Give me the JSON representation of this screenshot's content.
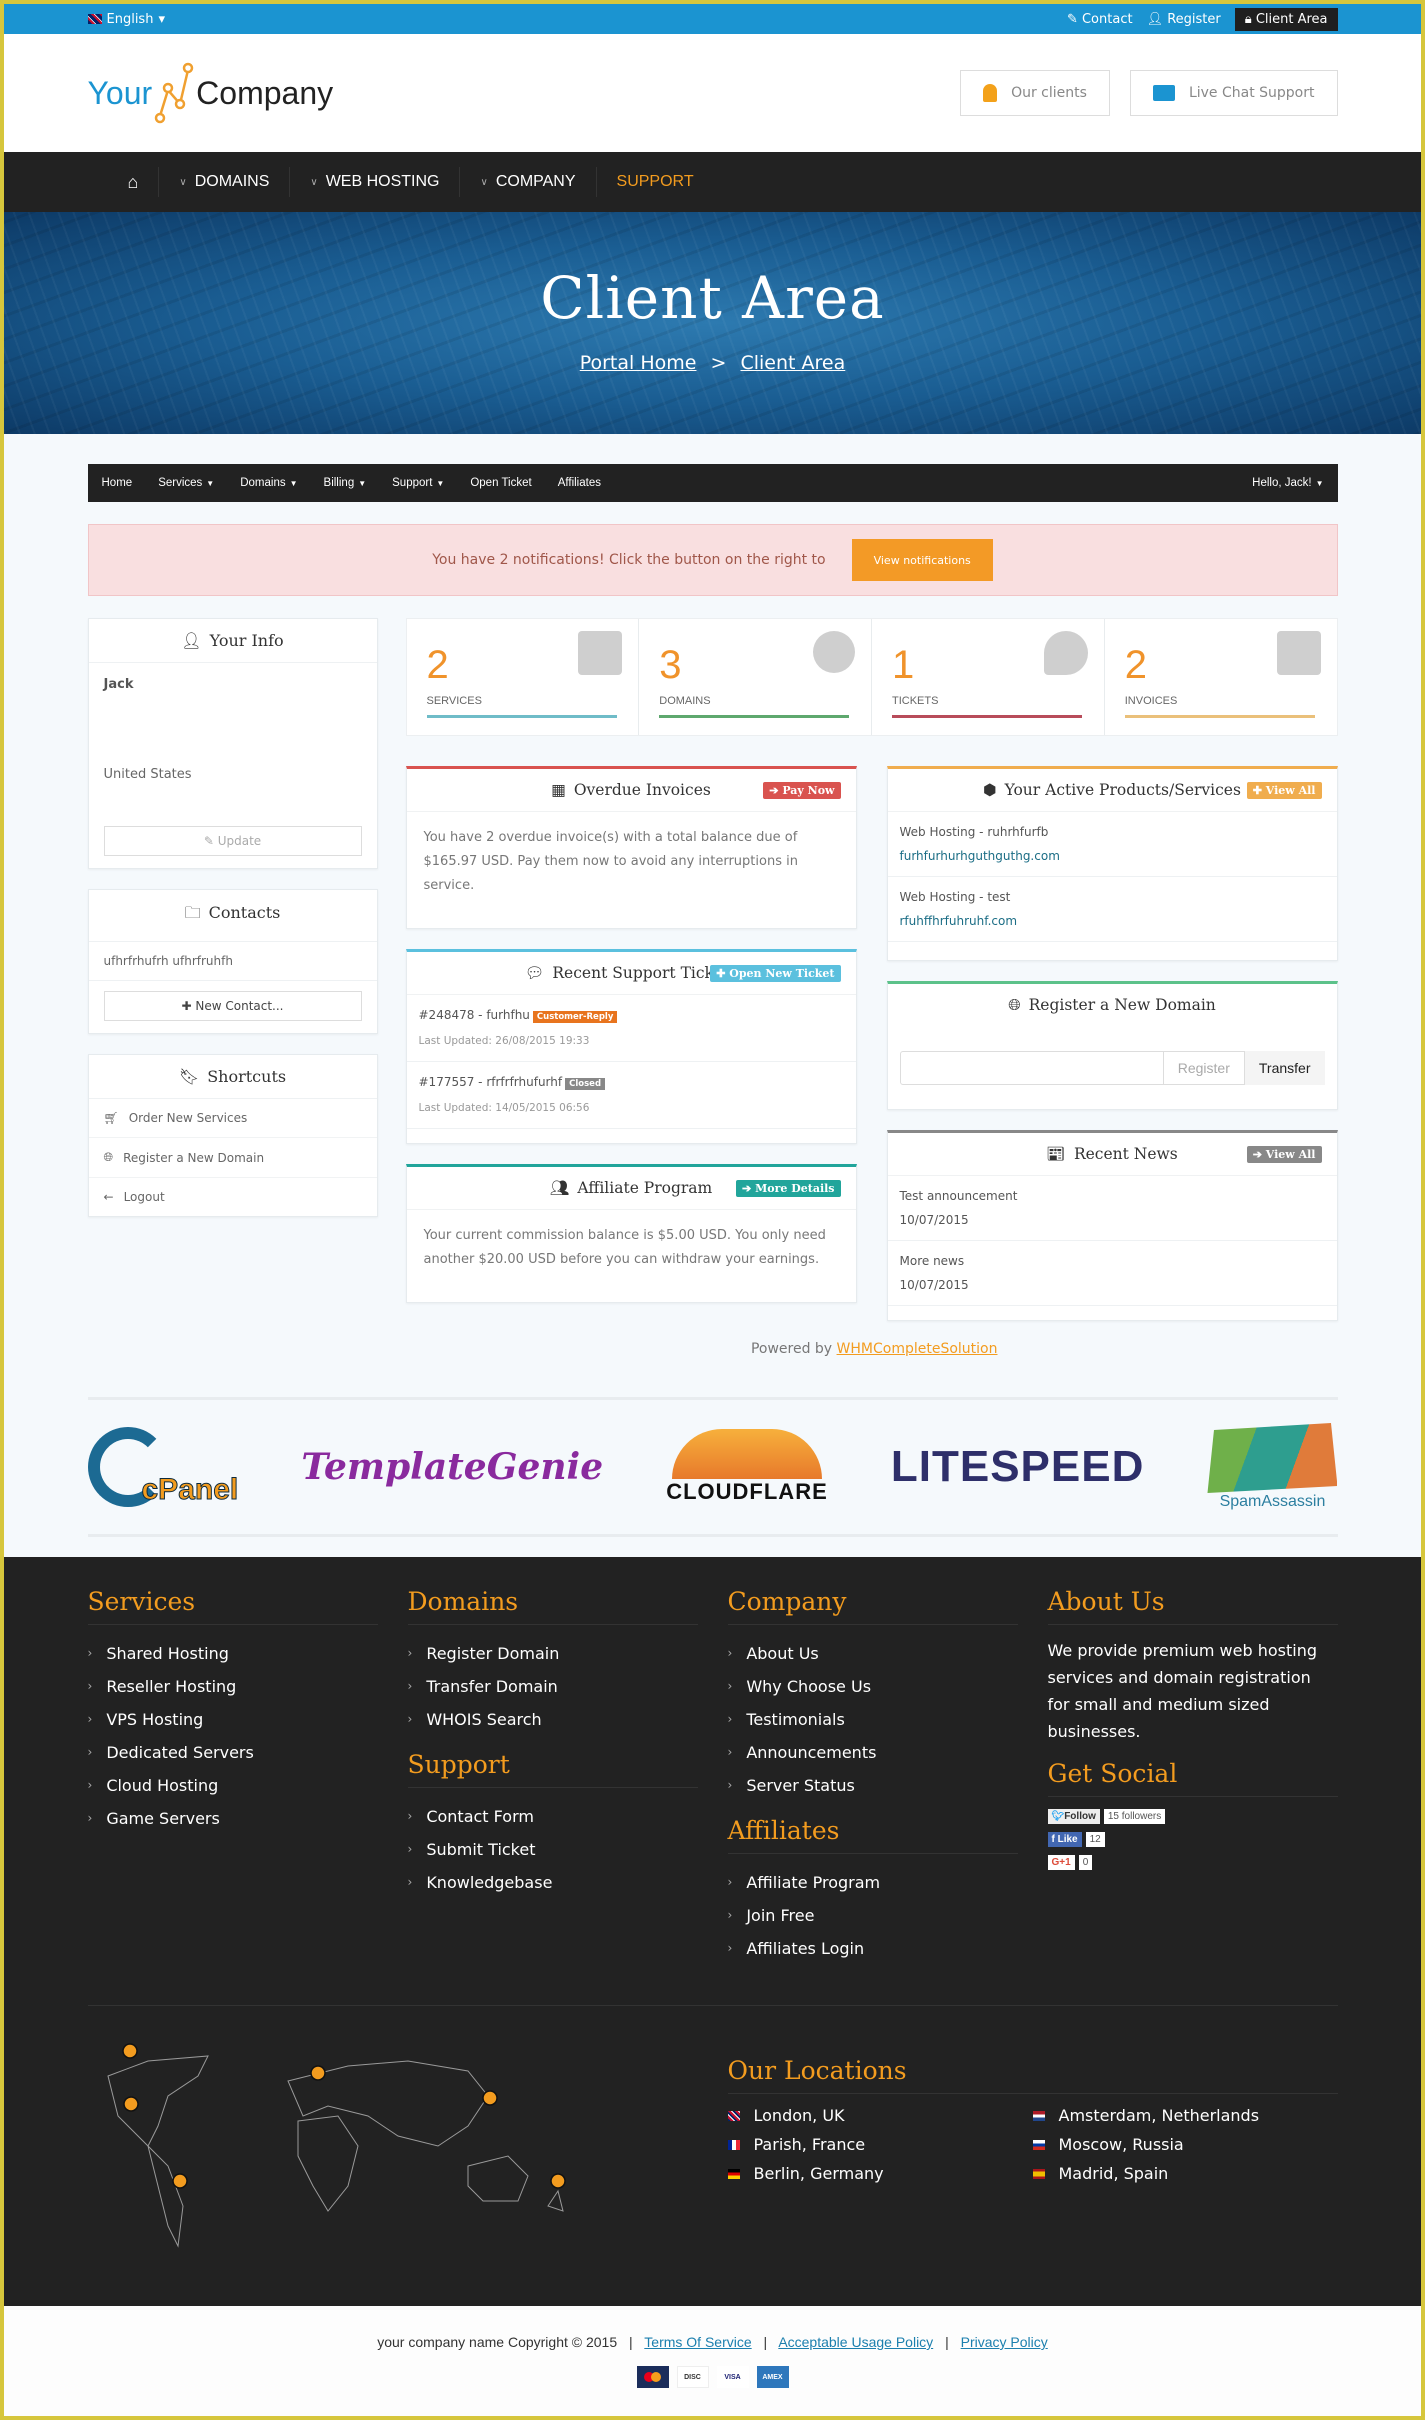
{
  "topbar": {
    "language": "English",
    "links": [
      {
        "icon": "edit-icon",
        "label": "Contact"
      },
      {
        "icon": "user-icon",
        "label": "Register"
      },
      {
        "icon": "lock-icon",
        "label": "Client Area"
      }
    ]
  },
  "header": {
    "logo_left": "Your",
    "logo_right": "Company",
    "buttons": [
      {
        "icon": "client-icon",
        "label": "Our clients"
      },
      {
        "icon": "chat-icon",
        "label": "Live Chat Support"
      }
    ]
  },
  "mainnav": {
    "items": [
      {
        "label": "DOMAINS",
        "dropdown": true
      },
      {
        "label": "WEB HOSTING",
        "dropdown": true
      },
      {
        "label": "COMPANY",
        "dropdown": true
      },
      {
        "label": "SUPPORT",
        "dropdown": false,
        "active": true
      }
    ]
  },
  "hero": {
    "title": "Client Area",
    "breadcrumb": [
      "Portal Home",
      "Client Area"
    ],
    "separator": ">"
  },
  "subnav": {
    "items": [
      {
        "label": "Home",
        "dropdown": false
      },
      {
        "label": "Services",
        "dropdown": true
      },
      {
        "label": "Domains",
        "dropdown": true
      },
      {
        "label": "Billing",
        "dropdown": true
      },
      {
        "label": "Support",
        "dropdown": true
      },
      {
        "label": "Open Ticket",
        "dropdown": false
      },
      {
        "label": "Affiliates",
        "dropdown": false
      }
    ],
    "user": "Hello, Jack!"
  },
  "alert": {
    "text": "You have 2 notifications! Click the button on the right to",
    "button": "View notifications"
  },
  "sidebar": {
    "your_info": {
      "title": "Your Info",
      "name": "Jack",
      "country": "United States",
      "button": "Update"
    },
    "contacts": {
      "title": "Contacts",
      "items": [
        "ufhrfrhufrh ufhrfruhfh"
      ],
      "button": "New Contact..."
    },
    "shortcuts": {
      "title": "Shortcuts",
      "items": [
        {
          "icon": "cart-icon",
          "label": "Order New Services"
        },
        {
          "icon": "globe-icon",
          "label": "Register a New Domain"
        },
        {
          "icon": "arrow-left-icon",
          "label": "Logout"
        }
      ]
    }
  },
  "stats": [
    {
      "value": "2",
      "label": "SERVICES",
      "color": "#6fbcc8",
      "icon": "cube-icon"
    },
    {
      "value": "3",
      "label": "DOMAINS",
      "color": "#5ea86e",
      "icon": "globe-icon"
    },
    {
      "value": "1",
      "label": "TICKETS",
      "color": "#b84c5a",
      "icon": "comments-icon"
    },
    {
      "value": "2",
      "label": "INVOICES",
      "color": "#eac07a",
      "icon": "credit-card-icon"
    }
  ],
  "overdue": {
    "title": "Overdue Invoices",
    "button": "Pay Now",
    "color": "#d9534f",
    "text": "You have 2 overdue invoice(s) with a total balance due of $165.97 USD. Pay them now to avoid any interruptions in service."
  },
  "tickets": {
    "title": "Recent Support Tickets",
    "button": "Open New Ticket",
    "color": "#5bc0de",
    "items": [
      {
        "subject": "#248478 - furhfhu",
        "status": "Customer-Reply",
        "status_color": "#e8741e",
        "updated": "Last Updated: 26/08/2015 19:33"
      },
      {
        "subject": "#177557 - rfrfrfrhufurhf",
        "status": "Closed",
        "status_color": "#888888",
        "updated": "Last Updated: 14/05/2015 06:56"
      }
    ]
  },
  "affiliate": {
    "title": "Affiliate Program",
    "button": "More Details",
    "color": "#21a59b",
    "text": "Your current commission balance is $5.00 USD. You only need another $20.00 USD before you can withdraw your earnings."
  },
  "products": {
    "title": "Your Active Products/Services",
    "button": "View All",
    "color": "#f0ad4e",
    "items": [
      {
        "name": "Web Hosting - ruhrhfurfb",
        "domain": "furhfurhurhguthguthg.com"
      },
      {
        "name": "Web Hosting - test",
        "domain": "rfuhffhrfuhruhf.com"
      }
    ]
  },
  "register_domain": {
    "title": "Register a New Domain",
    "color": "#5cc28a",
    "input_value": "",
    "register": "Register",
    "transfer": "Transfer"
  },
  "news": {
    "title": "Recent News",
    "button": "View All",
    "color": "#888888",
    "items": [
      {
        "title": "Test announcement",
        "date": "10/07/2015"
      },
      {
        "title": "More news",
        "date": "10/07/2015"
      }
    ]
  },
  "powered": {
    "prefix": "Powered by",
    "link": "WHMCompleteSolution"
  },
  "partners": [
    "cPanel",
    "TemplateGenie",
    "CLOUDFLARE",
    "LITESPEED",
    "SpamAssassin"
  ],
  "footer": {
    "services": {
      "title": "Services",
      "items": [
        "Shared Hosting",
        "Reseller Hosting",
        "VPS Hosting",
        "Dedicated Servers",
        "Cloud Hosting",
        "Game Servers"
      ]
    },
    "domains": {
      "title": "Domains",
      "items": [
        "Register Domain",
        "Transfer Domain",
        "WHOIS Search"
      ]
    },
    "support": {
      "title": "Support",
      "items": [
        "Contact Form",
        "Submit Ticket",
        "Knowledgebase"
      ]
    },
    "company": {
      "title": "Company",
      "items": [
        "About Us",
        "Why Choose Us",
        "Testimonials",
        "Announcements",
        "Server Status"
      ]
    },
    "affiliates": {
      "title": "Affiliates",
      "items": [
        "Affiliate Program",
        "Join Free",
        "Affiliates Login"
      ]
    },
    "about": {
      "title": "About Us",
      "text": "We provide premium web hosting services and domain registration for small and medium sized businesses."
    },
    "social": {
      "title": "Get Social",
      "twitter": {
        "label": "Follow",
        "count": "15 followers"
      },
      "facebook": {
        "label": "Like",
        "count": "12"
      },
      "google": {
        "label": "G+1",
        "count": "0"
      }
    },
    "locations": {
      "title": "Our Locations",
      "items": [
        {
          "city": "London, UK",
          "flag": "uk"
        },
        {
          "city": "Amsterdam, Netherlands",
          "flag": "nl"
        },
        {
          "city": "Parish, France",
          "flag": "fr"
        },
        {
          "city": "Moscow, Russia",
          "flag": "ru"
        },
        {
          "city": "Berlin, Germany",
          "flag": "de"
        },
        {
          "city": "Madrid, Spain",
          "flag": "es"
        }
      ]
    }
  },
  "bottom": {
    "copyright": "your company name Copyright © 2015",
    "links": [
      "Terms Of Service",
      "Acceptable Usage Policy",
      "Privacy Policy"
    ],
    "payment_cards": [
      "MasterCard",
      "Discover",
      "VISA",
      "American Express"
    ]
  }
}
